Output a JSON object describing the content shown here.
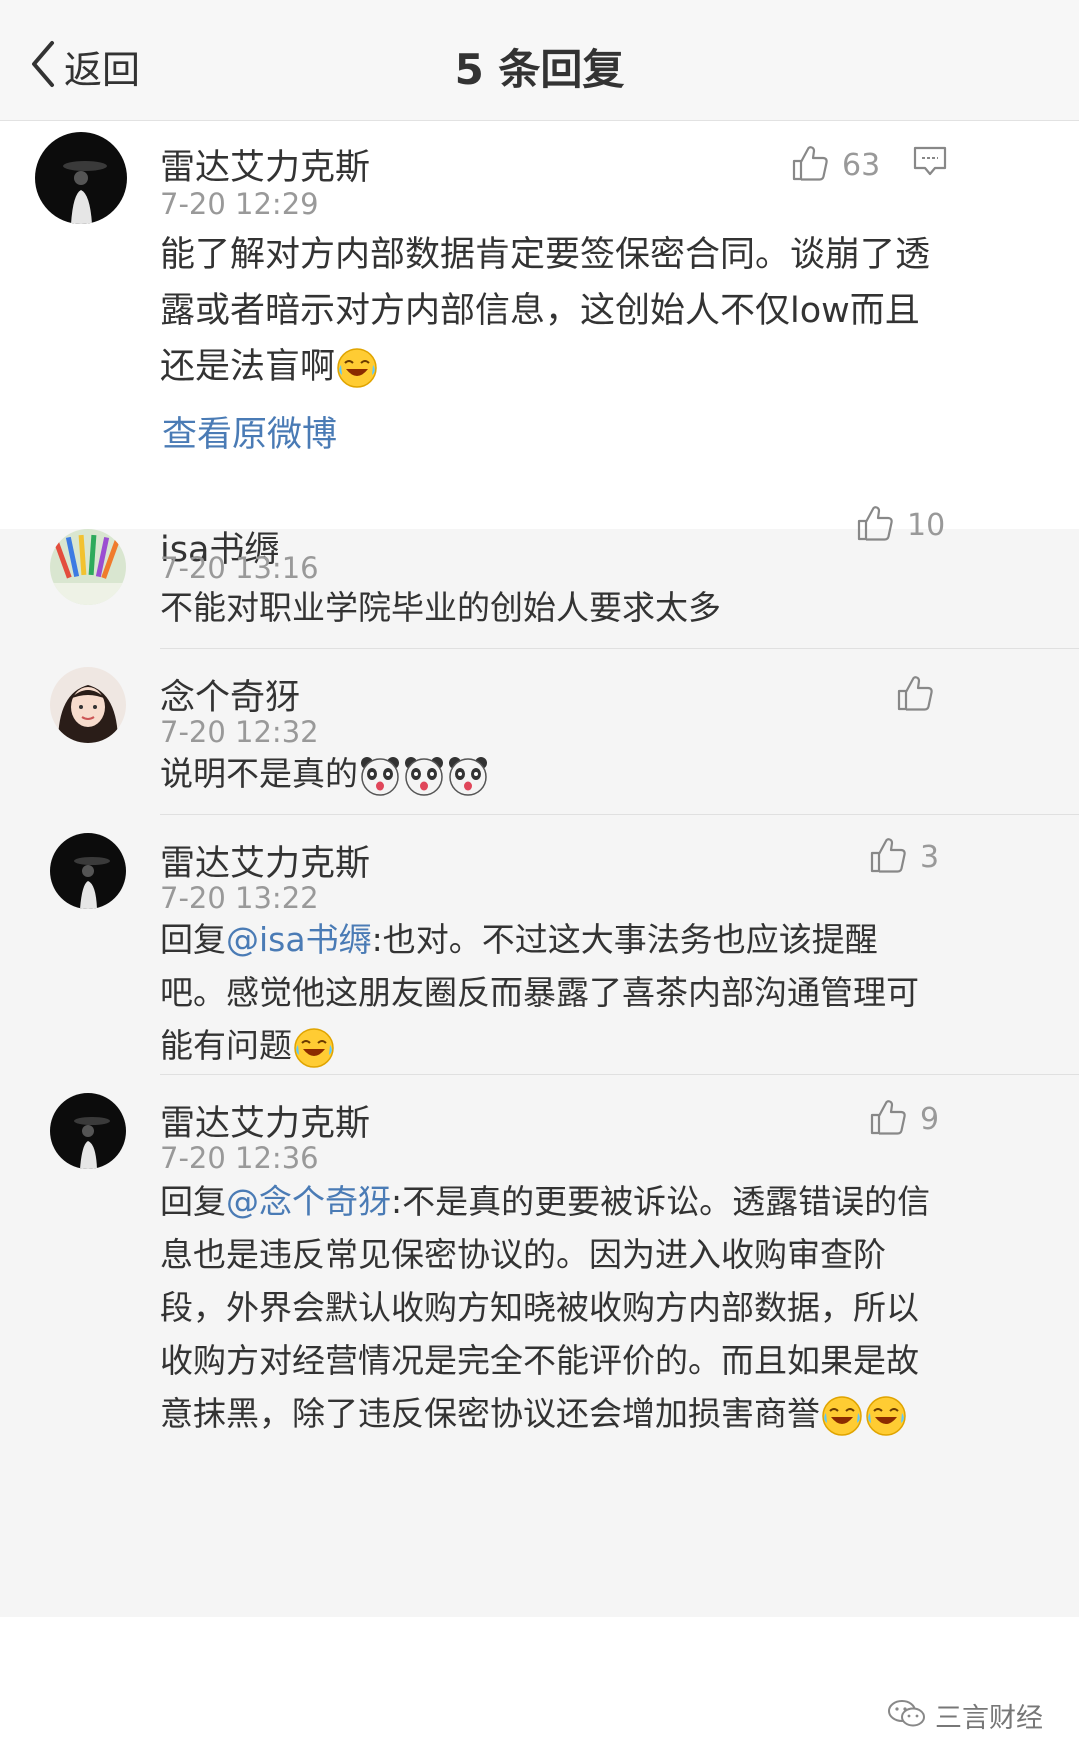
{
  "nav": {
    "back_label": "返回",
    "title": "5 条回复",
    "back_icon": "chevron-left-icon"
  },
  "main_comment": {
    "username": "雷达艾力克斯",
    "time": "7-20 12:29",
    "likes": "63",
    "text_lines": [
      "能了解对方内部数据肯定要签保密合同。谈崩了透",
      "露或者暗示对方内部信息，这创始人不仅low而且",
      "还是法盲啊"
    ],
    "view_original": "查看原微博"
  },
  "replies": [
    {
      "username": "isa书缛",
      "time": "7-20 13:16",
      "likes": "10",
      "text": "不能对职业学院毕业的创始人要求太多"
    },
    {
      "username": "念个奇犽",
      "time": "7-20 12:32",
      "likes": "",
      "text": "说明不是真的"
    },
    {
      "username": "雷达艾力克斯",
      "time": "7-20 13:22",
      "likes": "3",
      "prefix": "回复",
      "mention": "@isa书缛",
      "line1": ":也对。不过这大事法务也应该提醒",
      "line2": "吧。感觉他这朋友圈反而暴露了喜茶内部沟通管理可",
      "line3": "能有问题"
    },
    {
      "username": "雷达艾力克斯",
      "time": "7-20 12:36",
      "likes": "9",
      "prefix": "回复",
      "mention": "@念个奇犽",
      "line1": ":不是真的更要被诉讼。透露错误的信",
      "line2": "息也是违反常见保密协议的。因为进入收购审查阶",
      "line3": "段，外界会默认收购方知晓被收购方内部数据，所以",
      "line4": "收购方对经营情况是完全不能评价的。而且如果是故",
      "line5": "意抹黑，除了违反保密协议还会增加损害商誉"
    }
  ],
  "watermark": {
    "text": "三言财经"
  },
  "colors": {
    "link": "#4a7bb5",
    "meta": "#999999",
    "reply_bg": "#f5f5f5",
    "nav_bg": "#f7f7f7"
  },
  "icons": {
    "like": "thumbs-up-icon",
    "comment": "comment-bubble-icon",
    "emoji_laugh": "laugh-cry-emoji-icon",
    "emoji_panda": "panda-emoji-icon"
  }
}
